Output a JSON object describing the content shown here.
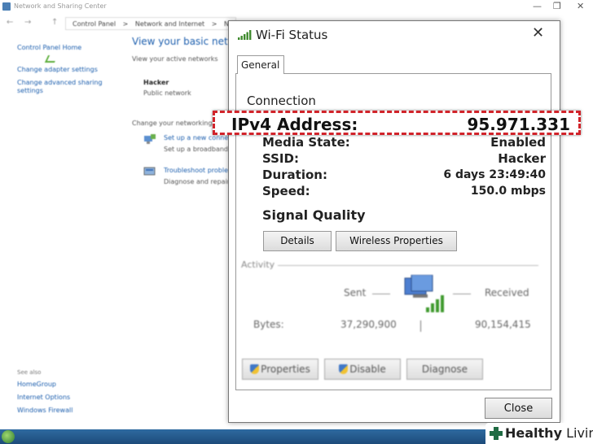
{
  "background_window": {
    "title": "Network and Sharing Center",
    "window_controls": [
      "—",
      "❐",
      "✕"
    ],
    "nav_arrows": [
      "←",
      "→",
      "↑"
    ],
    "breadcrumb": [
      "Control Panel",
      ">",
      "Network and Internet",
      ">",
      "N"
    ],
    "sidebar": {
      "items": [
        {
          "label": "Control Panel Home"
        },
        {
          "label": "Change adapter settings"
        },
        {
          "label": "Change advanced sharing settings"
        }
      ],
      "see_also_title": "See also",
      "see_also": [
        {
          "label": "HomeGroup"
        },
        {
          "label": "Internet Options"
        },
        {
          "label": "Windows Firewall"
        }
      ]
    },
    "main": {
      "heading": "View your basic network",
      "active_networks_label": "View your active networks",
      "network_name": "Hacker",
      "network_type": "Public network",
      "change_settings_label": "Change your networking",
      "task1_link": "Set up a new connec",
      "task1_desc": "Set up a broadband,",
      "task2_link": "Troubleshoot proble",
      "task2_desc": "Diagnose and repair"
    }
  },
  "dialog": {
    "title": "Wi-Fi Status",
    "close_glyph": "✕",
    "tab": "General",
    "connection_label": "Connection",
    "ipv4": {
      "label": "IPv4 Address:",
      "value": "95.971.331"
    },
    "rows": [
      {
        "label": "Media State:",
        "value": "Enabled"
      },
      {
        "label": "SSID:",
        "value": "Hacker"
      },
      {
        "label": "Duration:",
        "value": "6 days 23:49:40"
      },
      {
        "label": "Speed:",
        "value": "150.0 mbps"
      }
    ],
    "signal_quality_label": "Signal Quality",
    "details_button": "Details",
    "wireless_properties_button": "Wireless Properties",
    "activity": {
      "label": "Activity",
      "sent_label": "Sent",
      "received_label": "Received",
      "bytes_label": "Bytes:",
      "bytes_sent": "37,290,900",
      "bytes_received": "90,154,415"
    },
    "properties_button": "Properties",
    "disable_button": "Disable",
    "diagnose_button": "Diagnose",
    "close_button": "Close"
  },
  "watermark": {
    "brand_first": "Healthy",
    "brand_second": "Living"
  },
  "colors": {
    "highlight": "#d1232a",
    "link": "#1d5fae",
    "signal": "#5cae3b"
  }
}
